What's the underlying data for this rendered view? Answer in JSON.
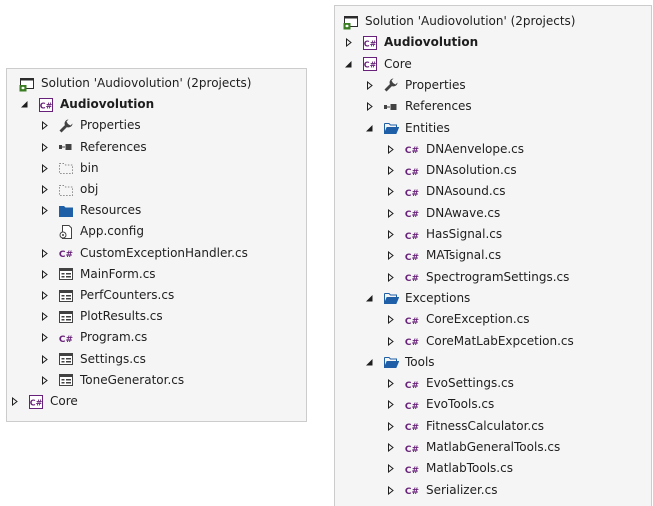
{
  "colors": {
    "panel_background": "#f5f5f5",
    "panel_border": "#cccccc",
    "text": "#1e1e1e",
    "csharp_purple": "#68217a",
    "folder_blue": "#1f5fa8",
    "wrench_gray": "#424242"
  },
  "left_tree": {
    "nodes": [
      {
        "label": "Solution 'Audiovolution' (2projects)",
        "icon": "solution-icon",
        "expander": "none",
        "depth": 0,
        "bold": false
      },
      {
        "label": "Audiovolution",
        "icon": "csharp-project-icon",
        "expander": "expanded",
        "depth": 0,
        "bold": true
      },
      {
        "label": "Properties",
        "icon": "wrench-icon",
        "expander": "collapsed",
        "depth": 1,
        "bold": false
      },
      {
        "label": "References",
        "icon": "references-icon",
        "expander": "collapsed",
        "depth": 1,
        "bold": false
      },
      {
        "label": "bin",
        "icon": "hidden-folder-icon",
        "expander": "collapsed",
        "depth": 1,
        "bold": false
      },
      {
        "label": "obj",
        "icon": "hidden-folder-icon",
        "expander": "collapsed",
        "depth": 1,
        "bold": false
      },
      {
        "label": "Resources",
        "icon": "folder-icon",
        "expander": "collapsed",
        "depth": 1,
        "bold": false
      },
      {
        "label": "App.config",
        "icon": "config-file-icon",
        "expander": "none",
        "depth": 1,
        "bold": false
      },
      {
        "label": "CustomExceptionHandler.cs",
        "icon": "csharp-file-icon",
        "expander": "collapsed",
        "depth": 1,
        "bold": false
      },
      {
        "label": "MainForm.cs",
        "icon": "form-file-icon",
        "expander": "collapsed",
        "depth": 1,
        "bold": false
      },
      {
        "label": "PerfCounters.cs",
        "icon": "form-file-icon",
        "expander": "collapsed",
        "depth": 1,
        "bold": false
      },
      {
        "label": "PlotResults.cs",
        "icon": "form-file-icon",
        "expander": "collapsed",
        "depth": 1,
        "bold": false
      },
      {
        "label": "Program.cs",
        "icon": "csharp-file-icon",
        "expander": "collapsed",
        "depth": 1,
        "bold": false
      },
      {
        "label": "Settings.cs",
        "icon": "form-file-icon",
        "expander": "collapsed",
        "depth": 1,
        "bold": false
      },
      {
        "label": "ToneGenerator.cs",
        "icon": "form-file-icon",
        "expander": "collapsed",
        "depth": 1,
        "bold": false
      },
      {
        "label": "Core",
        "icon": "csharp-project-icon",
        "expander": "collapsed",
        "depth": -1,
        "bold": false
      }
    ]
  },
  "right_tree": {
    "nodes": [
      {
        "label": "Solution 'Audiovolution' (2projects)",
        "icon": "solution-icon",
        "expander": "none",
        "depth": 0,
        "bold": false
      },
      {
        "label": "Audiovolution",
        "icon": "csharp-project-icon",
        "expander": "collapsed",
        "depth": 0,
        "bold": true
      },
      {
        "label": "Core",
        "icon": "csharp-project-icon",
        "expander": "expanded",
        "depth": 0,
        "bold": false
      },
      {
        "label": "Properties",
        "icon": "wrench-icon",
        "expander": "collapsed",
        "depth": 1,
        "bold": false
      },
      {
        "label": "References",
        "icon": "references-icon",
        "expander": "collapsed",
        "depth": 1,
        "bold": false
      },
      {
        "label": "Entities",
        "icon": "open-folder-icon",
        "expander": "expanded",
        "depth": 1,
        "bold": false
      },
      {
        "label": "DNAenvelope.cs",
        "icon": "csharp-file-icon",
        "expander": "collapsed",
        "depth": 2,
        "bold": false
      },
      {
        "label": "DNAsolution.cs",
        "icon": "csharp-file-icon",
        "expander": "collapsed",
        "depth": 2,
        "bold": false
      },
      {
        "label": "DNAsound.cs",
        "icon": "csharp-file-icon",
        "expander": "collapsed",
        "depth": 2,
        "bold": false
      },
      {
        "label": "DNAwave.cs",
        "icon": "csharp-file-icon",
        "expander": "collapsed",
        "depth": 2,
        "bold": false
      },
      {
        "label": "HasSignal.cs",
        "icon": "csharp-file-icon",
        "expander": "collapsed",
        "depth": 2,
        "bold": false
      },
      {
        "label": "MATsignal.cs",
        "icon": "csharp-file-icon",
        "expander": "collapsed",
        "depth": 2,
        "bold": false
      },
      {
        "label": "SpectrogramSettings.cs",
        "icon": "csharp-file-icon",
        "expander": "collapsed",
        "depth": 2,
        "bold": false
      },
      {
        "label": "Exceptions",
        "icon": "open-folder-icon",
        "expander": "expanded",
        "depth": 1,
        "bold": false
      },
      {
        "label": "CoreException.cs",
        "icon": "csharp-file-icon",
        "expander": "collapsed",
        "depth": 2,
        "bold": false
      },
      {
        "label": "CoreMatLabExpcetion.cs",
        "icon": "csharp-file-icon",
        "expander": "collapsed",
        "depth": 2,
        "bold": false
      },
      {
        "label": "Tools",
        "icon": "open-folder-icon",
        "expander": "expanded",
        "depth": 1,
        "bold": false
      },
      {
        "label": "EvoSettings.cs",
        "icon": "csharp-file-icon",
        "expander": "collapsed",
        "depth": 2,
        "bold": false
      },
      {
        "label": "EvoTools.cs",
        "icon": "csharp-file-icon",
        "expander": "collapsed",
        "depth": 2,
        "bold": false
      },
      {
        "label": "FitnessCalculator.cs",
        "icon": "csharp-file-icon",
        "expander": "collapsed",
        "depth": 2,
        "bold": false
      },
      {
        "label": "MatlabGeneralTools.cs",
        "icon": "csharp-file-icon",
        "expander": "collapsed",
        "depth": 2,
        "bold": false
      },
      {
        "label": "MatlabTools.cs",
        "icon": "csharp-file-icon",
        "expander": "collapsed",
        "depth": 2,
        "bold": false
      },
      {
        "label": "Serializer.cs",
        "icon": "csharp-file-icon",
        "expander": "collapsed",
        "depth": 2,
        "bold": false
      }
    ]
  }
}
